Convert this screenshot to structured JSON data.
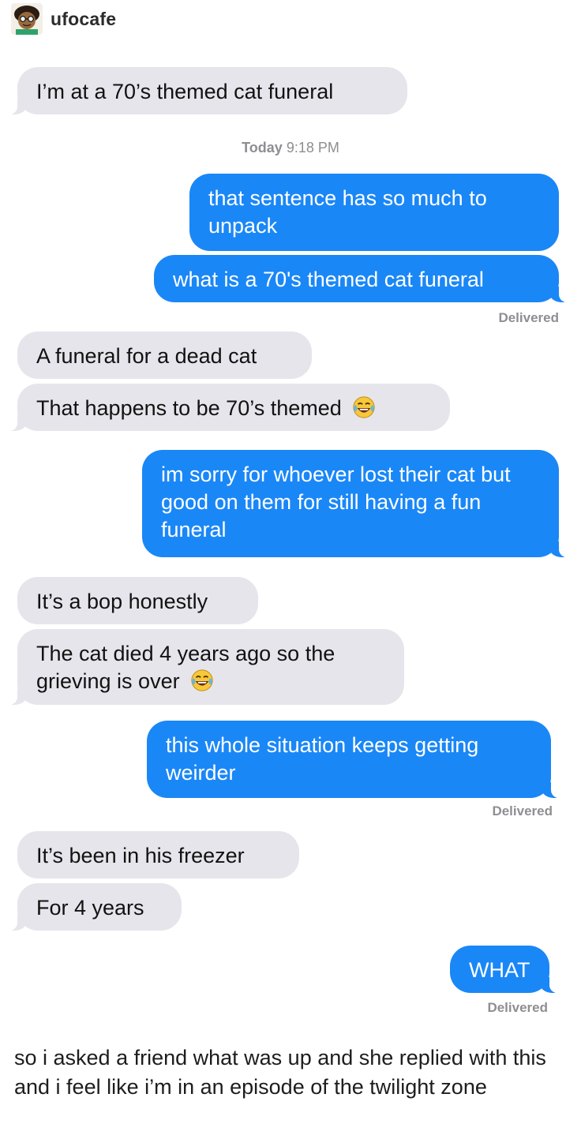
{
  "post": {
    "username": "ufocafe",
    "caption": "so i asked a friend what was up and she replied with this and i feel like i’m in an episode of the twilight zone"
  },
  "thread": {
    "timestamp_day": "Today",
    "timestamp_time": "9:18 PM",
    "delivered_label": "Delivered",
    "messages": [
      {
        "from": "them",
        "text": "I’m at a 70’s themed cat funeral"
      },
      {
        "from": "me",
        "text": "that sentence has so much to unpack"
      },
      {
        "from": "me",
        "text": "what is a 70's themed cat funeral"
      },
      {
        "from": "them",
        "text": "A funeral for a dead cat"
      },
      {
        "from": "them",
        "text": "That happens to be 70’s themed",
        "emoji": "laughing-crying-emoji"
      },
      {
        "from": "me",
        "text": "im sorry for whoever lost their cat but good on them for still having a fun funeral"
      },
      {
        "from": "them",
        "text": "It’s a bop honestly"
      },
      {
        "from": "them",
        "text": "The cat died 4 years ago so the grieving is over",
        "emoji": "laughing-crying-emoji"
      },
      {
        "from": "me",
        "text": "this whole situation keeps getting weirder"
      },
      {
        "from": "them",
        "text": "It’s been in his freezer"
      },
      {
        "from": "them",
        "text": "For 4 years"
      },
      {
        "from": "me",
        "text": "WHAT"
      }
    ]
  },
  "colors": {
    "sent_bubble": "#1a87f7",
    "received_bubble": "#e6e5eb",
    "meta_text": "#8e8e93"
  }
}
